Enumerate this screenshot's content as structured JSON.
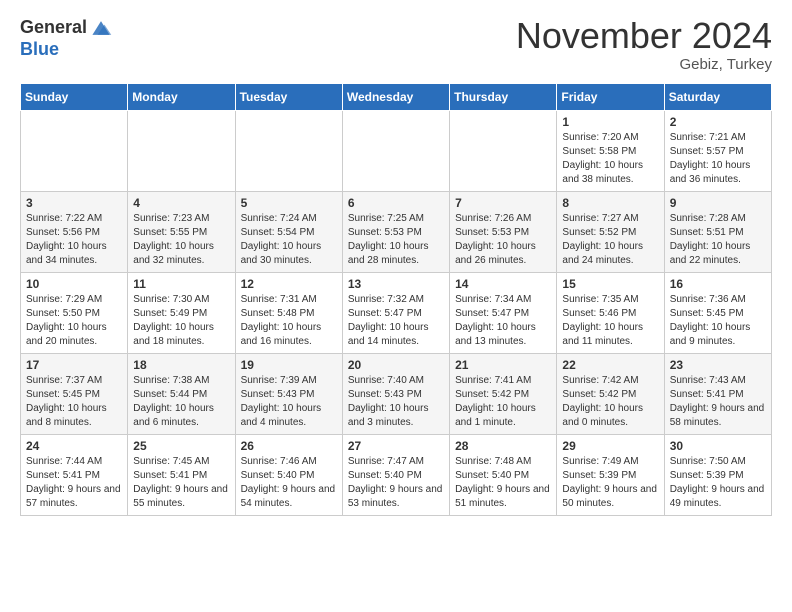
{
  "header": {
    "logo_general": "General",
    "logo_blue": "Blue",
    "month_title": "November 2024",
    "location": "Gebiz, Turkey"
  },
  "days_of_week": [
    "Sunday",
    "Monday",
    "Tuesday",
    "Wednesday",
    "Thursday",
    "Friday",
    "Saturday"
  ],
  "weeks": [
    [
      {
        "day": "",
        "info": ""
      },
      {
        "day": "",
        "info": ""
      },
      {
        "day": "",
        "info": ""
      },
      {
        "day": "",
        "info": ""
      },
      {
        "day": "",
        "info": ""
      },
      {
        "day": "1",
        "info": "Sunrise: 7:20 AM\nSunset: 5:58 PM\nDaylight: 10 hours and 38 minutes."
      },
      {
        "day": "2",
        "info": "Sunrise: 7:21 AM\nSunset: 5:57 PM\nDaylight: 10 hours and 36 minutes."
      }
    ],
    [
      {
        "day": "3",
        "info": "Sunrise: 7:22 AM\nSunset: 5:56 PM\nDaylight: 10 hours and 34 minutes."
      },
      {
        "day": "4",
        "info": "Sunrise: 7:23 AM\nSunset: 5:55 PM\nDaylight: 10 hours and 32 minutes."
      },
      {
        "day": "5",
        "info": "Sunrise: 7:24 AM\nSunset: 5:54 PM\nDaylight: 10 hours and 30 minutes."
      },
      {
        "day": "6",
        "info": "Sunrise: 7:25 AM\nSunset: 5:53 PM\nDaylight: 10 hours and 28 minutes."
      },
      {
        "day": "7",
        "info": "Sunrise: 7:26 AM\nSunset: 5:53 PM\nDaylight: 10 hours and 26 minutes."
      },
      {
        "day": "8",
        "info": "Sunrise: 7:27 AM\nSunset: 5:52 PM\nDaylight: 10 hours and 24 minutes."
      },
      {
        "day": "9",
        "info": "Sunrise: 7:28 AM\nSunset: 5:51 PM\nDaylight: 10 hours and 22 minutes."
      }
    ],
    [
      {
        "day": "10",
        "info": "Sunrise: 7:29 AM\nSunset: 5:50 PM\nDaylight: 10 hours and 20 minutes."
      },
      {
        "day": "11",
        "info": "Sunrise: 7:30 AM\nSunset: 5:49 PM\nDaylight: 10 hours and 18 minutes."
      },
      {
        "day": "12",
        "info": "Sunrise: 7:31 AM\nSunset: 5:48 PM\nDaylight: 10 hours and 16 minutes."
      },
      {
        "day": "13",
        "info": "Sunrise: 7:32 AM\nSunset: 5:47 PM\nDaylight: 10 hours and 14 minutes."
      },
      {
        "day": "14",
        "info": "Sunrise: 7:34 AM\nSunset: 5:47 PM\nDaylight: 10 hours and 13 minutes."
      },
      {
        "day": "15",
        "info": "Sunrise: 7:35 AM\nSunset: 5:46 PM\nDaylight: 10 hours and 11 minutes."
      },
      {
        "day": "16",
        "info": "Sunrise: 7:36 AM\nSunset: 5:45 PM\nDaylight: 10 hours and 9 minutes."
      }
    ],
    [
      {
        "day": "17",
        "info": "Sunrise: 7:37 AM\nSunset: 5:45 PM\nDaylight: 10 hours and 8 minutes."
      },
      {
        "day": "18",
        "info": "Sunrise: 7:38 AM\nSunset: 5:44 PM\nDaylight: 10 hours and 6 minutes."
      },
      {
        "day": "19",
        "info": "Sunrise: 7:39 AM\nSunset: 5:43 PM\nDaylight: 10 hours and 4 minutes."
      },
      {
        "day": "20",
        "info": "Sunrise: 7:40 AM\nSunset: 5:43 PM\nDaylight: 10 hours and 3 minutes."
      },
      {
        "day": "21",
        "info": "Sunrise: 7:41 AM\nSunset: 5:42 PM\nDaylight: 10 hours and 1 minute."
      },
      {
        "day": "22",
        "info": "Sunrise: 7:42 AM\nSunset: 5:42 PM\nDaylight: 10 hours and 0 minutes."
      },
      {
        "day": "23",
        "info": "Sunrise: 7:43 AM\nSunset: 5:41 PM\nDaylight: 9 hours and 58 minutes."
      }
    ],
    [
      {
        "day": "24",
        "info": "Sunrise: 7:44 AM\nSunset: 5:41 PM\nDaylight: 9 hours and 57 minutes."
      },
      {
        "day": "25",
        "info": "Sunrise: 7:45 AM\nSunset: 5:41 PM\nDaylight: 9 hours and 55 minutes."
      },
      {
        "day": "26",
        "info": "Sunrise: 7:46 AM\nSunset: 5:40 PM\nDaylight: 9 hours and 54 minutes."
      },
      {
        "day": "27",
        "info": "Sunrise: 7:47 AM\nSunset: 5:40 PM\nDaylight: 9 hours and 53 minutes."
      },
      {
        "day": "28",
        "info": "Sunrise: 7:48 AM\nSunset: 5:40 PM\nDaylight: 9 hours and 51 minutes."
      },
      {
        "day": "29",
        "info": "Sunrise: 7:49 AM\nSunset: 5:39 PM\nDaylight: 9 hours and 50 minutes."
      },
      {
        "day": "30",
        "info": "Sunrise: 7:50 AM\nSunset: 5:39 PM\nDaylight: 9 hours and 49 minutes."
      }
    ]
  ]
}
